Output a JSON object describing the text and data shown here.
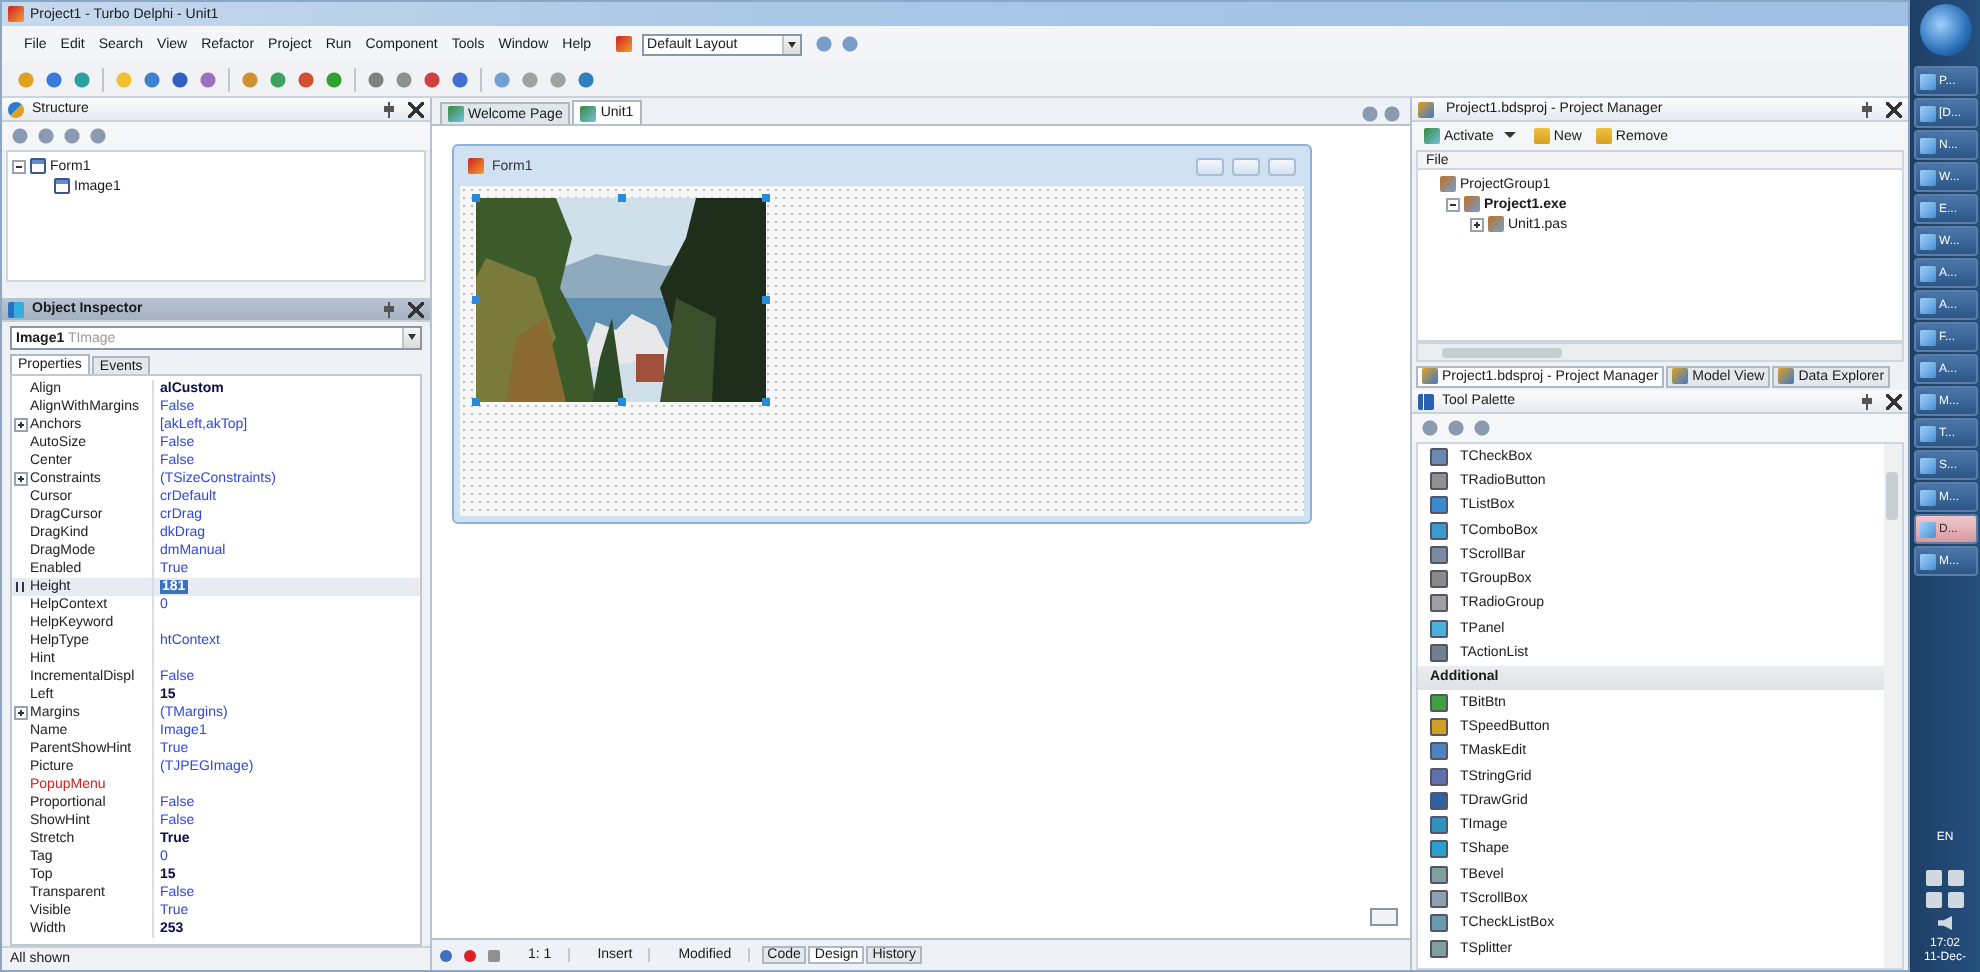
{
  "window": {
    "title": "Project1 - Turbo Delphi - Unit1"
  },
  "menu": [
    "File",
    "Edit",
    "Search",
    "View",
    "Refactor",
    "Project",
    "Run",
    "Component",
    "Tools",
    "Window",
    "Help"
  ],
  "layout_combo": {
    "value": "Default Layout"
  },
  "structure": {
    "title": "Structure",
    "tree": [
      {
        "label": "Form1",
        "expanded": true,
        "children": [
          {
            "label": "Image1"
          }
        ]
      }
    ]
  },
  "object_inspector": {
    "title": "Object Inspector",
    "selector": {
      "name": "Image1",
      "type": "TImage"
    },
    "tabs": [
      {
        "label": "Properties",
        "selected": true
      },
      {
        "label": "Events",
        "selected": false
      }
    ],
    "properties": [
      {
        "kind": "simple",
        "name": "Align",
        "value": "alCustom",
        "modified": true,
        "selected": false
      },
      {
        "kind": "simple",
        "name": "AlignWithMargins",
        "value": "False",
        "modified": false,
        "selected": false
      },
      {
        "kind": "group",
        "name": "Anchors",
        "value": "[akLeft,akTop]",
        "modified": false,
        "selected": false
      },
      {
        "kind": "simple",
        "name": "AutoSize",
        "value": "False",
        "modified": false,
        "selected": false
      },
      {
        "kind": "simple",
        "name": "Center",
        "value": "False",
        "modified": false,
        "selected": false
      },
      {
        "kind": "group",
        "name": "Constraints",
        "value": "(TSizeConstraints)",
        "modified": false,
        "selected": false
      },
      {
        "kind": "simple",
        "name": "Cursor",
        "value": "crDefault",
        "modified": false,
        "selected": false
      },
      {
        "kind": "simple",
        "name": "DragCursor",
        "value": "crDrag",
        "modified": false,
        "selected": false
      },
      {
        "kind": "simple",
        "name": "DragKind",
        "value": "dkDrag",
        "modified": false,
        "selected": false
      },
      {
        "kind": "simple",
        "name": "DragMode",
        "value": "dmManual",
        "modified": false,
        "selected": false
      },
      {
        "kind": "simple",
        "name": "Enabled",
        "value": "True",
        "modified": false,
        "selected": false
      },
      {
        "kind": "simple",
        "name": "Height",
        "value": "181",
        "modified": true,
        "selected": true
      },
      {
        "kind": "simple",
        "name": "HelpContext",
        "value": "0",
        "modified": false,
        "selected": false
      },
      {
        "kind": "simple",
        "name": "HelpKeyword",
        "selected": false
      },
      {
        "kind": "simple",
        "name": "HelpType",
        "value": "htContext",
        "modified": false,
        "selected": false
      },
      {
        "kind": "simple",
        "name": "Hint",
        "selected": false
      },
      {
        "kind": "simple",
        "name": "IncrementalDispl",
        "value": "False",
        "modified": false,
        "selected": false
      },
      {
        "kind": "simple",
        "name": "Left",
        "value": "15",
        "modified": true,
        "selected": false
      },
      {
        "kind": "group",
        "name": "Margins",
        "value": "(TMargins)",
        "modified": false,
        "selected": false
      },
      {
        "kind": "simple",
        "name": "Name",
        "value": "Image1",
        "modified": false,
        "selected": false
      },
      {
        "kind": "simple",
        "name": "ParentShowHint",
        "value": "True",
        "modified": false,
        "selected": false
      },
      {
        "kind": "simple",
        "name": "Picture",
        "value": "(TJPEGImage)",
        "modified": false,
        "selected": false
      },
      {
        "kind": "reference",
        "name": "PopupMenu",
        "selected": false
      },
      {
        "kind": "simple",
        "name": "Proportional",
        "value": "False",
        "modified": false,
        "selected": false
      },
      {
        "kind": "simple",
        "name": "ShowHint",
        "value": "False",
        "modified": false,
        "selected": false
      },
      {
        "kind": "simple",
        "name": "Stretch",
        "value": "True",
        "modified": true,
        "selected": false
      },
      {
        "kind": "simple",
        "name": "Tag",
        "value": "0",
        "modified": false,
        "selected": false
      },
      {
        "kind": "simple",
        "name": "Top",
        "value": "15",
        "modified": true,
        "selected": false
      },
      {
        "kind": "simple",
        "name": "Transparent",
        "value": "False",
        "modified": false,
        "selected": false
      },
      {
        "kind": "simple",
        "name": "Visible",
        "value": "True",
        "modified": false,
        "selected": false
      },
      {
        "kind": "simple",
        "name": "Width",
        "value": "253",
        "modified": true,
        "selected": false
      }
    ],
    "status": "All shown"
  },
  "editor": {
    "tabs": [
      {
        "label": "Welcome Page",
        "selected": false
      },
      {
        "label": "Unit1",
        "selected": true
      }
    ],
    "form": {
      "caption": "Form1"
    },
    "status": {
      "position": "1: 1",
      "mode": "Insert",
      "state": "Modified"
    },
    "view_tabs": [
      {
        "label": "Code",
        "selected": false
      },
      {
        "label": "Design",
        "selected": true
      },
      {
        "label": "History",
        "selected": false
      }
    ]
  },
  "project_manager": {
    "title": "Project1.bdsproj - Project Manager",
    "toolbar": [
      "Activate",
      "New",
      "Remove"
    ],
    "column": "File",
    "tree": [
      {
        "label": "ProjectGroup1",
        "bold": false,
        "children": [
          {
            "label": "Project1.exe",
            "bold": true,
            "expanded": true,
            "children": [
              {
                "label": "Unit1.pas",
                "bold": false,
                "expanded": false
              }
            ]
          }
        ]
      }
    ],
    "tabs": [
      {
        "label": "Project1.bdsproj - Project Manager",
        "selected": true
      },
      {
        "label": "Model View",
        "selected": false
      },
      {
        "label": "Data Explorer",
        "selected": false
      }
    ]
  },
  "tool_palette": {
    "title": "Tool Palette",
    "items": [
      {
        "kind": "component",
        "label": "TCheckBox"
      },
      {
        "kind": "component",
        "label": "TRadioButton"
      },
      {
        "kind": "component",
        "label": "TListBox"
      },
      {
        "kind": "component",
        "label": "TComboBox"
      },
      {
        "kind": "component",
        "label": "TScrollBar"
      },
      {
        "kind": "component",
        "label": "TGroupBox"
      },
      {
        "kind": "component",
        "label": "TRadioGroup"
      },
      {
        "kind": "component",
        "label": "TPanel"
      },
      {
        "kind": "component",
        "label": "TActionList"
      },
      {
        "kind": "category",
        "label": "Additional"
      },
      {
        "kind": "component",
        "label": "TBitBtn"
      },
      {
        "kind": "component",
        "label": "TSpeedButton"
      },
      {
        "kind": "component",
        "label": "TMaskEdit"
      },
      {
        "kind": "component",
        "label": "TStringGrid"
      },
      {
        "kind": "component",
        "label": "TDrawGrid"
      },
      {
        "kind": "component",
        "label": "TImage"
      },
      {
        "kind": "component",
        "label": "TShape"
      },
      {
        "kind": "component",
        "label": "TBevel"
      },
      {
        "kind": "component",
        "label": "TScrollBox"
      },
      {
        "kind": "component",
        "label": "TCheckListBox"
      },
      {
        "kind": "component",
        "label": "TSplitter"
      }
    ]
  },
  "taskbar": {
    "buttons": [
      {
        "label": "P...",
        "selected": false
      },
      {
        "label": "[D...",
        "selected": false
      },
      {
        "label": "N...",
        "selected": false
      },
      {
        "label": "W...",
        "selected": false
      },
      {
        "label": "E...",
        "selected": false
      },
      {
        "label": "W...",
        "selected": false
      },
      {
        "label": "A...",
        "selected": false
      },
      {
        "label": "A...",
        "selected": false
      },
      {
        "label": "F...",
        "selected": false
      },
      {
        "label": "A...",
        "selected": false
      },
      {
        "label": "M...",
        "selected": false
      },
      {
        "label": "T...",
        "selected": false
      },
      {
        "label": "S...",
        "selected": false
      },
      {
        "label": "M...",
        "selected": false
      },
      {
        "label": "D...",
        "selected": true
      },
      {
        "label": "M...",
        "selected": false
      }
    ],
    "language": "EN",
    "time": "17:02",
    "date": "11-Dec-"
  }
}
